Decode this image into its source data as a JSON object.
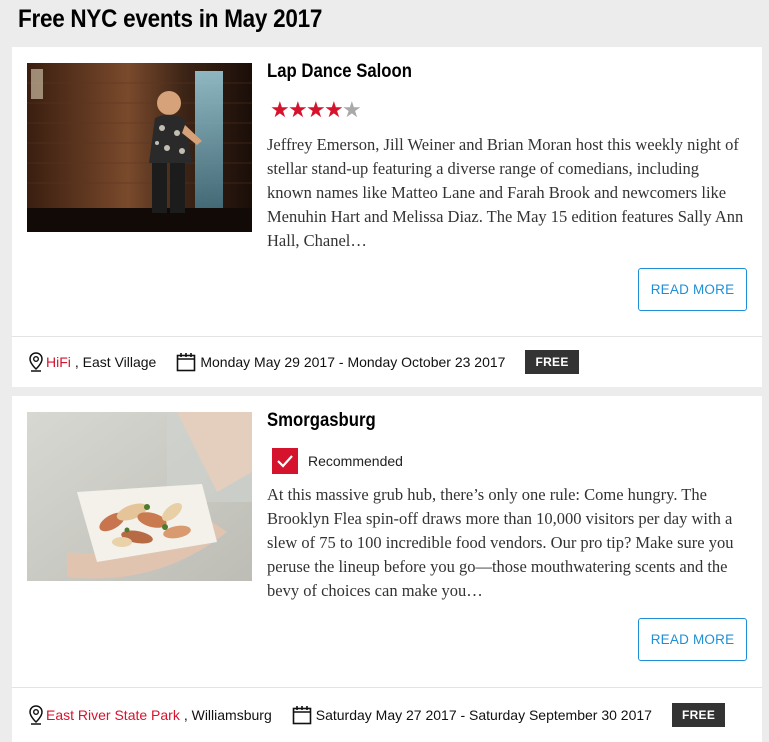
{
  "page": {
    "title": "Free NYC events in May 2017"
  },
  "events": [
    {
      "title": "Lap Dance Saloon",
      "rating": {
        "value": 4,
        "max": 5
      },
      "description": "Jeffrey Emerson, Jill Weiner and Brian Moran host this weekly night of stellar stand-up featuring a diverse range of comedians, including known names like Matteo Lane and Farah Brook and newcomers like Menuhin Hart and Melissa Diaz. The May 15 edition features Sally Ann Hall, Chanel…",
      "read_more_label": "READ MORE",
      "venue": "HiFi",
      "area": ", East Village",
      "dates": "Monday May 29 2017 - Monday October 23 2017",
      "badge": "FREE"
    },
    {
      "title": "Smorgasburg",
      "recommended_label": "Recommended",
      "description": "At this massive grub hub, there’s only one rule: Come hungry. The Brooklyn Flea spin-off draws more than 10,000 visitors per day with a slew of 75 to 100 incredible food vendors. Our pro tip? Make sure you peruse the lineup before you go—those mouthwatering scents and the bevy of choices can make you…",
      "read_more_label": "READ MORE",
      "venue": "East River State Park",
      "area": ", Williamsburg",
      "dates": "Saturday May 27 2017 - Saturday September 30 2017",
      "badge": "FREE"
    }
  ],
  "colors": {
    "accent_red": "#d6132d",
    "link_blue": "#1e8fd6",
    "badge_bg": "#333333",
    "page_bg": "#ececec"
  },
  "icons": [
    "map-pin-icon",
    "calendar-icon",
    "star-icon",
    "checkmark-icon"
  ]
}
